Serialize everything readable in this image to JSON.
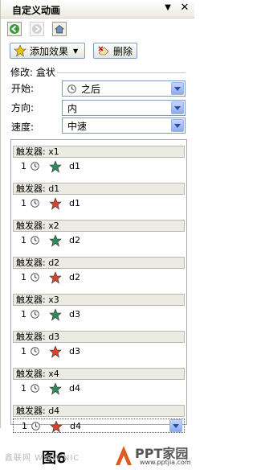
{
  "pane": {
    "title": "自定义动画",
    "toolbar": {
      "add_effect_label": "添加效果",
      "delete_label": "删除"
    },
    "modify_label": "修改: 盒状",
    "fields": {
      "start_label": "开始:",
      "start_value": "之后",
      "direction_label": "方向:",
      "direction_value": "内",
      "speed_label": "速度:",
      "speed_value": "中速"
    },
    "list": [
      {
        "trigger": "触发器: x1",
        "num": "1",
        "effect": "entrance",
        "name": "d1"
      },
      {
        "trigger": "触发器: d1",
        "num": "1",
        "effect": "exit",
        "name": "d1"
      },
      {
        "trigger": "触发器: x2",
        "num": "1",
        "effect": "entrance",
        "name": "d2"
      },
      {
        "trigger": "触发器: d2",
        "num": "1",
        "effect": "exit",
        "name": "d2"
      },
      {
        "trigger": "触发器: x3",
        "num": "1",
        "effect": "entrance",
        "name": "d3"
      },
      {
        "trigger": "触发器: d3",
        "num": "1",
        "effect": "exit",
        "name": "d3"
      },
      {
        "trigger": "触发器: x4",
        "num": "1",
        "effect": "entrance",
        "name": "d4"
      },
      {
        "trigger": "触发器: d4",
        "num": "1",
        "effect": "exit",
        "name": "d4"
      }
    ]
  },
  "caption": "图6",
  "watermark": "鑫联网 WWW.NIC",
  "logo_text": "PPT家园",
  "logo_url": "www.pptjia.com",
  "colors": {
    "entrance_star": "#2e8b57",
    "exit_star": "#d9412b",
    "drop_blue": "#3a6fd8"
  }
}
